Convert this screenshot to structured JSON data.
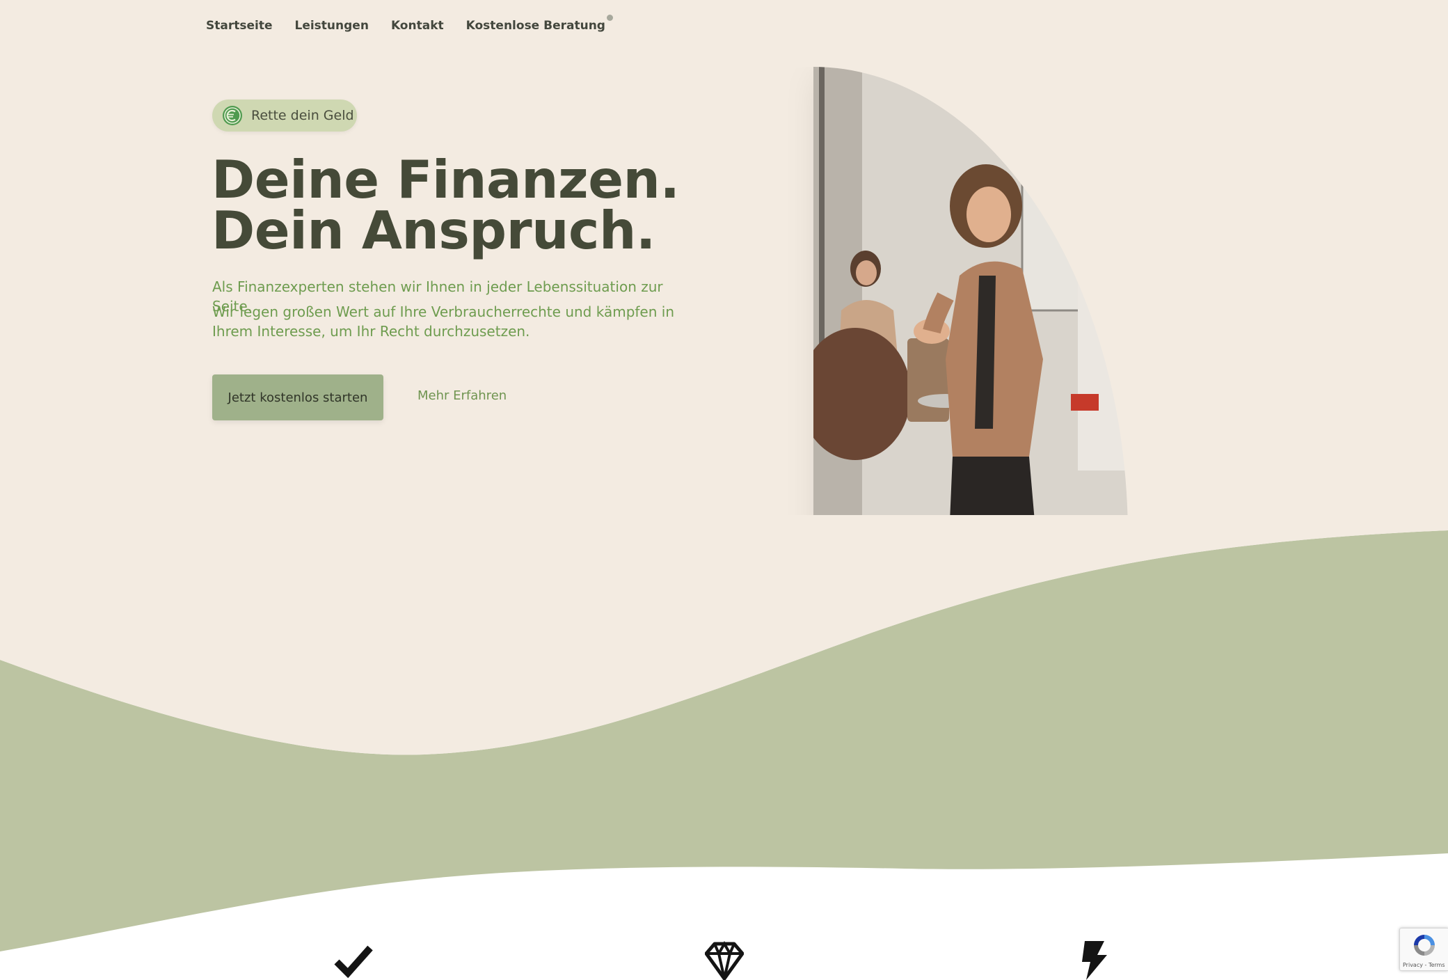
{
  "nav": {
    "items": [
      {
        "label": "Startseite"
      },
      {
        "label": "Leistungen"
      },
      {
        "label": "Kontakt"
      },
      {
        "label": "Kostenlose Beratung"
      }
    ]
  },
  "hero": {
    "badge": {
      "label": "Rette dein Geld",
      "icon": "euro-leaf-icon"
    },
    "title_line1": "Deine Finanzen.",
    "title_line2": "Dein Anspruch.",
    "text_1": "Als Finanzexperten stehen wir Ihnen in jeder Lebenssituation zur Seite.",
    "text_2": "Wir legen großen Wert auf Ihre Verbraucherrechte und kämpfen in Ihrem Interesse, um Ihr Recht durchzusetzen.",
    "primary_button": "Jetzt kostenlos starten",
    "secondary_link": "Mehr Erfahren",
    "image": "presenter-photo"
  },
  "features": {
    "icons": [
      "check-icon",
      "diamond-icon",
      "bolt-icon"
    ]
  },
  "recaptcha": {
    "text": "Privacy - Terms"
  },
  "colors": {
    "background": "#f3ebe1",
    "sage": "#bcc4a2",
    "button": "#9fb18a",
    "badge": "#cfd8b2",
    "text_dark": "#454a38",
    "text_green": "#6e9c4f"
  }
}
